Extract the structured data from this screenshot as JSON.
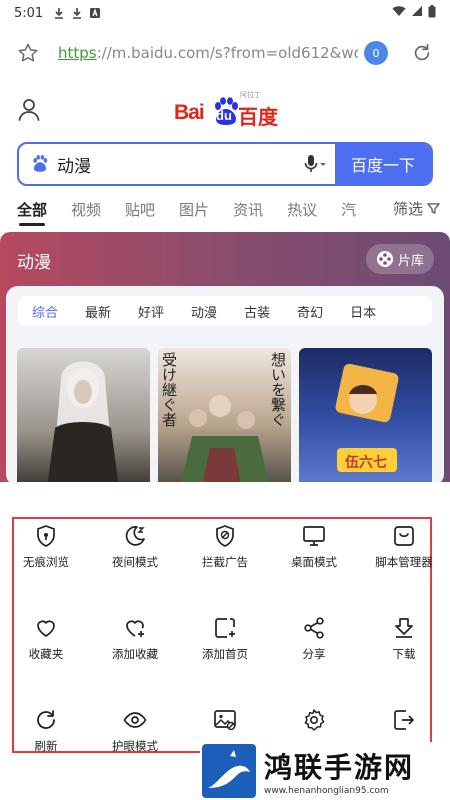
{
  "status_bar": {
    "time": "5:01"
  },
  "url_bar": {
    "url_scheme": "https",
    "url_rest": "://m.baidu.com/s?from=old612&wo...",
    "tab_count": "0"
  },
  "logo": {
    "bai": "Bai",
    "du": "du",
    "cn": "百度",
    "small": "阿拉丁"
  },
  "search": {
    "query": "动漫",
    "button": "百度一下"
  },
  "nav_tabs": [
    "全部",
    "视频",
    "贴吧",
    "图片",
    "资讯",
    "热议",
    "汽"
  ],
  "filter_label": "筛选",
  "card": {
    "title": "动漫",
    "library_button": "片库",
    "chips": [
      "综合",
      "最新",
      "好评",
      "动漫",
      "古装",
      "奇幻",
      "日本"
    ],
    "thumb2_text_col1": "受け継ぐ者",
    "thumb2_text_col2": "想いを繋ぐ",
    "thumb3_text": "伍六七"
  },
  "menu_items": [
    {
      "label": "无痕浏览",
      "icon": "shield-lock-icon"
    },
    {
      "label": "夜间模式",
      "icon": "moon-icon"
    },
    {
      "label": "拦截广告",
      "icon": "ad-block-icon"
    },
    {
      "label": "桌面模式",
      "icon": "monitor-icon"
    },
    {
      "label": "脚本管理器",
      "icon": "script-icon"
    },
    {
      "label": "收藏夹",
      "icon": "heart-icon"
    },
    {
      "label": "添加收藏",
      "icon": "heart-plus-icon"
    },
    {
      "label": "添加首页",
      "icon": "add-home-icon"
    },
    {
      "label": "分享",
      "icon": "share-icon"
    },
    {
      "label": "下载",
      "icon": "download-icon"
    },
    {
      "label": "刷新",
      "icon": "refresh-icon"
    },
    {
      "label": "护眼模式",
      "icon": "eye-icon"
    },
    {
      "label": "",
      "icon": "image-off-icon"
    },
    {
      "label": "",
      "icon": "settings-icon"
    },
    {
      "label": "",
      "icon": "exit-icon"
    }
  ],
  "watermark": {
    "title": "鸿联手游网",
    "site": "www.henanhonglian95.com"
  },
  "colors": {
    "accent": "#4e6ef2",
    "brand_red": "#e1251b",
    "frame": "#e23b3b"
  }
}
